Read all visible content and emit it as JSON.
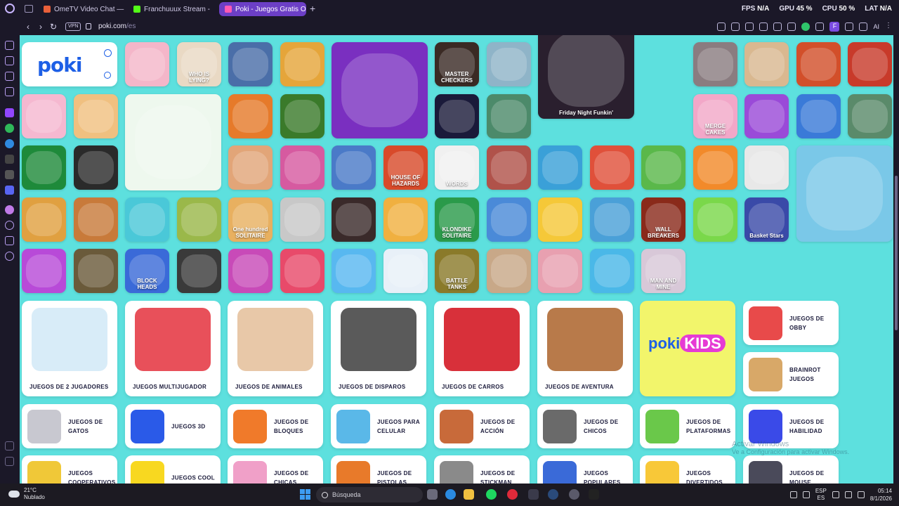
{
  "browser": {
    "tabs": [
      {
        "label": "OmeTV Video Chat — Ome",
        "color": "#e9603a"
      },
      {
        "label": "Franchuuux Stream - ",
        "color": "#53fc18"
      },
      {
        "label": "Poki - Juegos Gratis Online",
        "color": "#ff5ab4"
      }
    ],
    "new_tab": "+",
    "stats": {
      "fps_label": "FPS",
      "fps": "N/A",
      "gpu_label": "GPU",
      "gpu": "45 %",
      "cpu_label": "CPU",
      "cpu": "50 %",
      "lat_label": "LAT",
      "lat": "N/A"
    },
    "vpn": "VPN",
    "url_main": "poki.com",
    "url_path": "/es",
    "profile_letter": "F",
    "ai_label": "AI"
  },
  "poki": {
    "logo": "poki"
  },
  "tiles": [
    {
      "label": "",
      "color": "#f4b6c9"
    },
    {
      "label": "WHO IS LYING?",
      "color": "#e9d9c4"
    },
    {
      "label": "",
      "color": "#4a6ea8"
    },
    {
      "label": "",
      "color": "#e5a53a"
    },
    {
      "label": "",
      "color": "#7a2fc0"
    },
    {
      "label": "MASTER CHECKERS",
      "color": "#3a2a24"
    },
    {
      "label": "",
      "color": "#8fb4c8"
    },
    {
      "label": "Friday Night Funkin'",
      "color": "#2a1f2e"
    },
    {
      "label": "",
      "color": "#8a7c80"
    },
    {
      "label": "",
      "color": "#d9b890"
    },
    {
      "label": "",
      "color": "#d24f2a"
    },
    {
      "label": "",
      "color": "#c83a2a"
    },
    {
      "label": "",
      "color": "#f5b8d0"
    },
    {
      "label": "",
      "color": "#f0c080"
    },
    {
      "label": "",
      "color": "#eef8ee"
    },
    {
      "label": "",
      "color": "#e67a2a"
    },
    {
      "label": "",
      "color": "#3a7a2a"
    },
    {
      "label": "",
      "color": "#1a1a3a"
    },
    {
      "label": "",
      "color": "#4c8a6a"
    },
    {
      "label": "MERGE CAKES",
      "color": "#f2a7c8"
    },
    {
      "label": "",
      "color": "#9a4ad8"
    },
    {
      "label": "",
      "color": "#3a7ad8"
    },
    {
      "label": "",
      "color": "#5a8a6a"
    },
    {
      "label": "",
      "color": "#1e8a3a"
    },
    {
      "label": "",
      "color": "#2a2a2a"
    },
    {
      "label": "",
      "color": "#e2a578"
    },
    {
      "label": "",
      "color": "#d65aa0"
    },
    {
      "label": "",
      "color": "#4a7ac8"
    },
    {
      "label": "HOUSE OF HAZARDS",
      "color": "#d84a2a"
    },
    {
      "label": "WORDS",
      "color": "#f0f0f0"
    },
    {
      "label": "",
      "color": "#b0524a"
    },
    {
      "label": "",
      "color": "#3aa0d8"
    },
    {
      "label": "",
      "color": "#e0503a"
    },
    {
      "label": "",
      "color": "#5ab84a"
    },
    {
      "label": "",
      "color": "#f28a2a"
    },
    {
      "label": "",
      "color": "#e8e8e8"
    },
    {
      "label": "",
      "color": "#7ac8e8"
    },
    {
      "label": "",
      "color": "#e0a040"
    },
    {
      "label": "",
      "color": "#c87a3a"
    },
    {
      "label": "",
      "color": "#4ac8d8"
    },
    {
      "label": "",
      "color": "#9ab84a"
    },
    {
      "label": "One hundred SOLITAIRE",
      "color": "#e8b060"
    },
    {
      "label": "",
      "color": "#c8c8c8"
    },
    {
      "label": "",
      "color": "#3a2a2a"
    },
    {
      "label": "",
      "color": "#f0b040"
    },
    {
      "label": "KLONDIKE SOLITAIRE",
      "color": "#2a9a4a"
    },
    {
      "label": "",
      "color": "#4a8ad8"
    },
    {
      "label": "",
      "color": "#f5c838"
    },
    {
      "label": "",
      "color": "#4aa0d8"
    },
    {
      "label": "WALL BREAKERS",
      "color": "#8a2a1a"
    },
    {
      "label": "",
      "color": "#7ad84a"
    },
    {
      "label": "Basket Stars",
      "color": "#3a4aa8"
    },
    {
      "label": "",
      "color": "#b84ad8"
    },
    {
      "label": "",
      "color": "#6a5a3a"
    },
    {
      "label": "BLOCK HEADS",
      "color": "#3a6ad8"
    },
    {
      "label": "",
      "color": "#3a3a3a"
    },
    {
      "label": "",
      "color": "#c84ab8"
    },
    {
      "label": "",
      "color": "#e84a6a"
    },
    {
      "label": "",
      "color": "#58b8f0"
    },
    {
      "label": "",
      "color": "#e8f0f8"
    },
    {
      "label": "BATTLE TANKS",
      "color": "#8a7a2a"
    },
    {
      "label": "",
      "color": "#c8a888"
    },
    {
      "label": "",
      "color": "#e8a0b0"
    },
    {
      "label": "",
      "color": "#4ab8e8"
    },
    {
      "label": "MAN AND MINE",
      "color": "#d8c8d8"
    },
    {
      "label": "",
      "color": "#88c858"
    }
  ],
  "categories_big": [
    {
      "label": "JUEGOS DE 2 JUGADORES",
      "color": "#d8ecf8"
    },
    {
      "label": "JUEGOS MULTIJUGADOR",
      "color": "#e8505a"
    },
    {
      "label": "JUEGOS DE ANIMALES",
      "color": "#e8c8a8"
    },
    {
      "label": "JUEGOS DE DISPAROS",
      "color": "#5a5a5a"
    },
    {
      "label": "JUEGOS DE CARROS",
      "color": "#d8303a"
    },
    {
      "label": "JUEGOS DE AVENTURA",
      "color": "#b87a4a"
    }
  ],
  "kids": {
    "poki": "poki",
    "kids": "KIDS"
  },
  "categories_right": [
    {
      "label": "JUEGOS DE OBBY",
      "color": "#e84a4a"
    },
    {
      "label": "BRAINROT JUEGOS",
      "color": "#d8a868"
    }
  ],
  "categories_small": [
    {
      "label": "JUEGOS DE GATOS",
      "color": "#c8c8d0"
    },
    {
      "label": "JUEGOS 3D",
      "color": "#2a5ae8"
    },
    {
      "label": "JUEGOS DE BLOQUES",
      "color": "#f07a2a"
    },
    {
      "label": "JUEGOS PARA CELULAR",
      "color": "#5ab8e8"
    },
    {
      "label": "JUEGOS DE ACCIÓN",
      "color": "#c86a3a"
    },
    {
      "label": "JUEGOS DE CHICOS",
      "color": "#6a6a6a"
    },
    {
      "label": "JUEGOS DE PLATAFORMAS",
      "color": "#6ac84a"
    },
    {
      "label": "JUEGOS DE HABILIDAD",
      "color": "#3a4ae8"
    },
    {
      "label": "JUEGOS COOPERATIVOS",
      "color": "#f0c838"
    },
    {
      "label": "JUEGOS COOL",
      "color": "#f8d820"
    },
    {
      "label": "JUEGOS DE CHICAS",
      "color": "#f0a0c8"
    },
    {
      "label": "JUEGOS DE PISTOLAS",
      "color": "#e87a2a"
    },
    {
      "label": "JUEGOS DE STICKMAN",
      "color": "#8a8a8a"
    },
    {
      "label": "JUEGOS POPULARES",
      "color": "#3a6ad8"
    },
    {
      "label": "JUEGOS DIVERTIDOS",
      "color": "#f8c838"
    },
    {
      "label": "JUEGOS DE MOUSE",
      "color": "#4a4a5a"
    }
  ],
  "watermark": {
    "line1": "Activar Windows",
    "line2": "Ve a Configuración para activar Windows."
  },
  "taskbar": {
    "temp": "21°C",
    "condition": "Nublado",
    "search": "Búsqueda",
    "lang1": "ESP",
    "lang2": "ES",
    "time": "05:14",
    "date": "8/1/2026"
  }
}
